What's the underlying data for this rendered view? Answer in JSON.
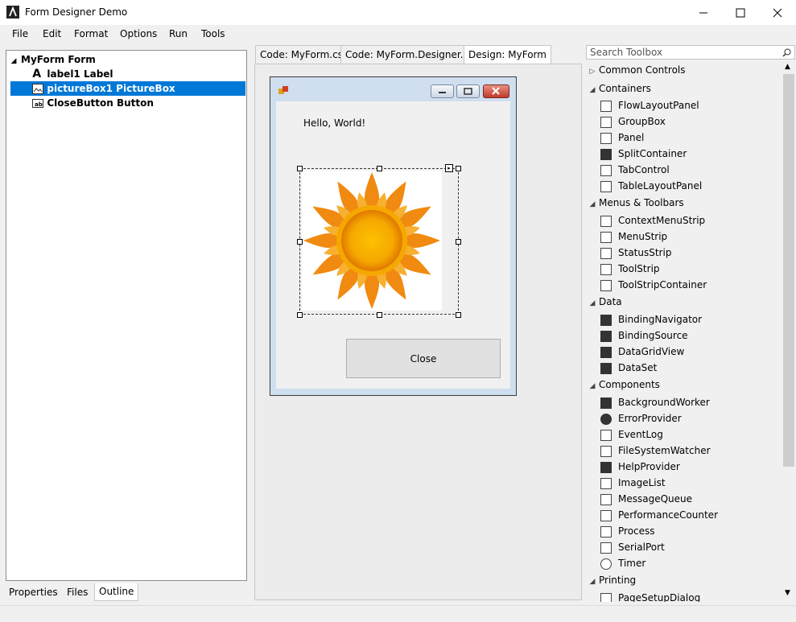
{
  "window": {
    "title": "Form Designer Demo"
  },
  "menu": [
    "File",
    "Edit",
    "Format",
    "Options",
    "Run",
    "Tools"
  ],
  "outline": {
    "items": [
      {
        "label": "MyForm Form"
      },
      {
        "label": "label1 Label"
      },
      {
        "label": "pictureBox1 PictureBox"
      },
      {
        "label": "CloseButton Button"
      }
    ]
  },
  "left_tabs": [
    "Properties",
    "Files",
    "Outline"
  ],
  "editor_tabs": [
    "Code: MyForm.cs",
    "Code: MyForm.Designer.cs",
    "Design: MyForm"
  ],
  "form": {
    "label_text": "Hello, World!",
    "close_button": "Close"
  },
  "toolbox": {
    "search_placeholder": "Search Toolbox",
    "categories": [
      {
        "name": "Common Controls",
        "expanded": false,
        "items": []
      },
      {
        "name": "Containers",
        "expanded": true,
        "items": [
          "FlowLayoutPanel",
          "GroupBox",
          "Panel",
          "SplitContainer",
          "TabControl",
          "TableLayoutPanel"
        ]
      },
      {
        "name": "Menus & Toolbars",
        "expanded": true,
        "items": [
          "ContextMenuStrip",
          "MenuStrip",
          "StatusStrip",
          "ToolStrip",
          "ToolStripContainer"
        ]
      },
      {
        "name": "Data",
        "expanded": true,
        "items": [
          "BindingNavigator",
          "BindingSource",
          "DataGridView",
          "DataSet"
        ]
      },
      {
        "name": "Components",
        "expanded": true,
        "items": [
          "BackgroundWorker",
          "ErrorProvider",
          "EventLog",
          "FileSystemWatcher",
          "HelpProvider",
          "ImageList",
          "MessageQueue",
          "PerformanceCounter",
          "Process",
          "SerialPort",
          "Timer"
        ]
      },
      {
        "name": "Printing",
        "expanded": true,
        "items": [
          "PageSetupDialog"
        ]
      }
    ]
  },
  "colors": {
    "selection": "#0078d7",
    "sun_core": "#f5a800",
    "sun_rays": "#f08a10"
  }
}
